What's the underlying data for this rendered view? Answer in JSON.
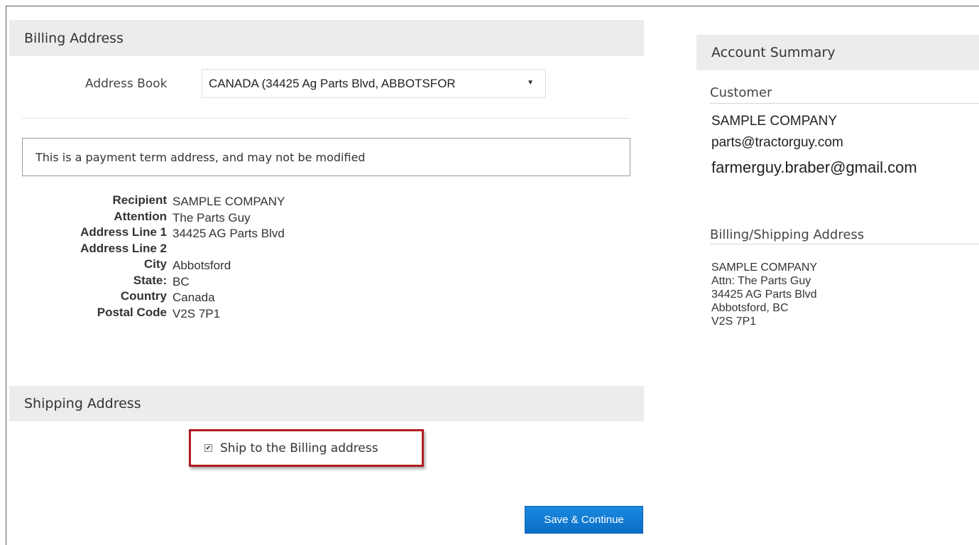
{
  "billing": {
    "title": "Billing Address",
    "address_book_label": "Address Book",
    "address_book_value": "CANADA (34425 Ag Parts Blvd, ABBOTSFOR",
    "notice": "This is a payment term address, and may not be modified",
    "fields": [
      {
        "key": "Recipient",
        "value": "SAMPLE COMPANY"
      },
      {
        "key": "Attention",
        "value": "The Parts Guy"
      },
      {
        "key": "Address Line 1",
        "value": "34425 AG Parts Blvd"
      },
      {
        "key": "Address Line 2",
        "value": ""
      },
      {
        "key": "City",
        "value": "Abbotsford"
      },
      {
        "key": "State:",
        "value": "BC"
      },
      {
        "key": "Country",
        "value": "Canada"
      },
      {
        "key": "Postal Code",
        "value": "V2S 7P1"
      }
    ]
  },
  "shipping": {
    "title": "Shipping Address",
    "ship_to_billing_label": "Ship to the Billing address",
    "ship_to_billing_checked": true,
    "checkmark": "✔"
  },
  "actions": {
    "save_label": "Save & Continue"
  },
  "account_summary": {
    "title": "Account Summary",
    "customer_title": "Customer",
    "customer_name": "SAMPLE COMPANY",
    "customer_email_1": "parts@tractorguy.com",
    "customer_email_2": "farmerguy.braber@gmail.com",
    "address_title": "Billing/Shipping Address",
    "address_lines": [
      "SAMPLE COMPANY",
      "Attn: The Parts Guy",
      "34425 AG Parts Blvd",
      "Abbotsford, BC",
      "V2S 7P1"
    ]
  },
  "colors": {
    "header_bg": "#ececec",
    "highlight_border": "#b01c22",
    "button_bg": "#0a6dc6"
  }
}
